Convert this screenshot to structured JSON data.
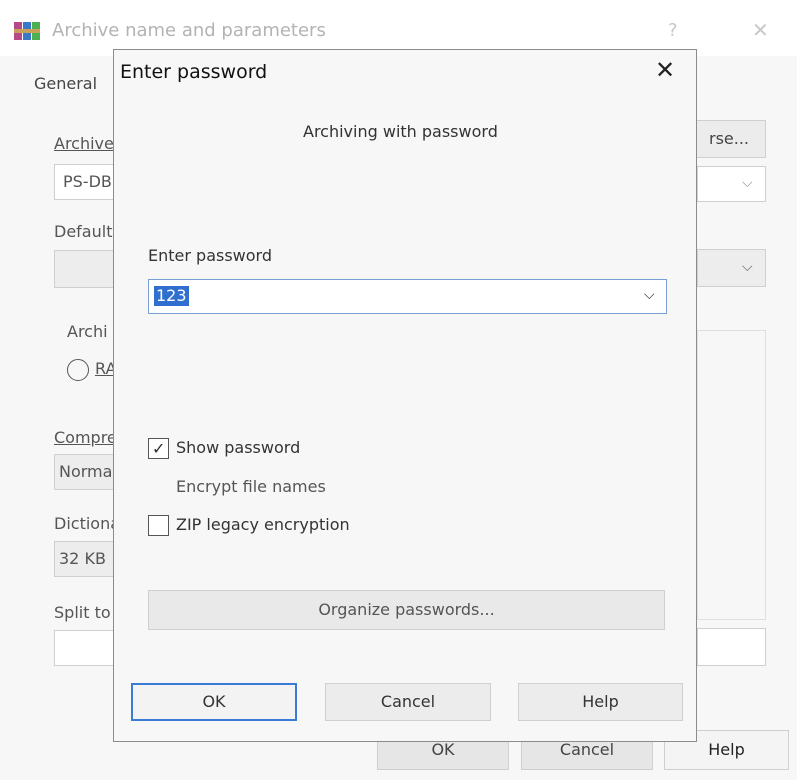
{
  "background_dialog": {
    "title": "Archive name and parameters",
    "help_glyph": "?",
    "close_glyph": "✕",
    "tab_general": "General",
    "archive_label": "Archive",
    "archive_value": "PS-DB",
    "browse_label": "rse...",
    "default_label": "Default",
    "archive_format_label": "Archi",
    "rar_option": "RA",
    "compression_label": "Compre",
    "compression_value": "Norma",
    "dictionary_label": "Dictiona",
    "dictionary_value": "32 KB",
    "split_label": "Split to",
    "ok_label": "OK",
    "cancel_label": "Cancel",
    "help_label": "Help"
  },
  "modal": {
    "title": "Enter password",
    "close_glyph": "✕",
    "subtitle": "Archiving with password",
    "password_label": "Enter password",
    "password_value": "123",
    "dropdown_glyph": "⌵",
    "show_password": {
      "label": "Show password",
      "checked": true
    },
    "encrypt_file_names": {
      "label": "Encrypt file names",
      "checked": false
    },
    "zip_legacy": {
      "label": "ZIP legacy encryption",
      "checked": false
    },
    "organize_label": "Organize passwords...",
    "ok_label": "OK",
    "cancel_label": "Cancel",
    "help_label": "Help"
  },
  "colors": {
    "accent": "#3a7bd5",
    "selection": "#2f6fd0"
  }
}
